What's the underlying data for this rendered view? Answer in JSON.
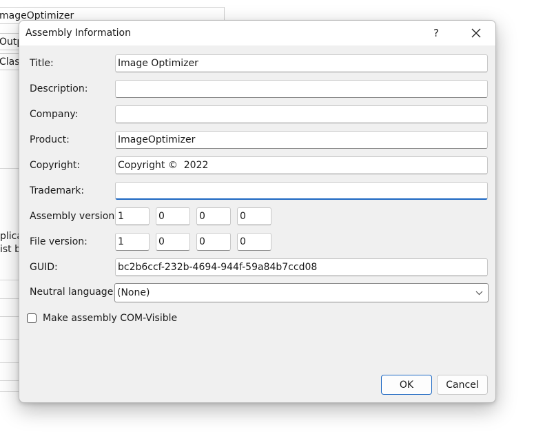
{
  "background": {
    "field1_text": "mageOptimizer",
    "field2_text": "Outp",
    "field3_text": "Class",
    "text_line1": "plica",
    "text_line2": "ist b"
  },
  "dialog": {
    "title": "Assembly Information",
    "help_glyph": "?",
    "close_glyph": "✕",
    "fields": {
      "title": {
        "label": "Title:",
        "value": "Image Optimizer"
      },
      "description": {
        "label": "Description:",
        "value": ""
      },
      "company": {
        "label": "Company:",
        "value": ""
      },
      "product": {
        "label": "Product:",
        "value": "ImageOptimizer"
      },
      "copyright": {
        "label": "Copyright:",
        "value": "Copyright ©  2022"
      },
      "trademark": {
        "label": "Trademark:",
        "value": ""
      },
      "assembly_version": {
        "label": "Assembly version:",
        "parts": [
          "1",
          "0",
          "0",
          "0"
        ]
      },
      "file_version": {
        "label": "File version:",
        "parts": [
          "1",
          "0",
          "0",
          "0"
        ]
      },
      "guid": {
        "label": "GUID:",
        "value": "bc2b6ccf-232b-4694-944f-59a84b7ccd08"
      },
      "neutral_language": {
        "label": "Neutral language:",
        "selected": "(None)"
      }
    },
    "com_visible": {
      "label": "Make assembly COM-Visible",
      "checked": false
    },
    "buttons": {
      "ok": "OK",
      "cancel": "Cancel"
    }
  },
  "icons": {
    "help": "help-icon",
    "close": "close-icon",
    "dropdown": "chevron-down-icon"
  },
  "colors": {
    "accent": "#1a66c2",
    "dialog_bg": "#f0f0f0"
  }
}
